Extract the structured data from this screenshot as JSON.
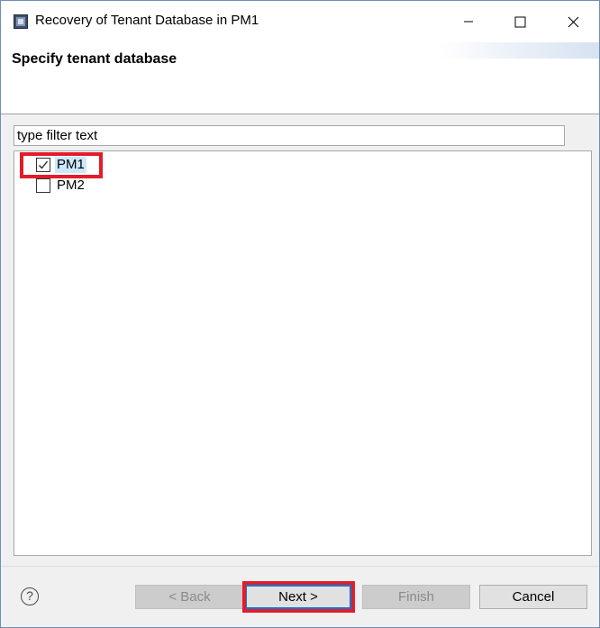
{
  "window": {
    "title": "Recovery of Tenant Database in PM1",
    "icon": "database-app-icon",
    "controls": [
      "minimize-icon",
      "maximize-icon",
      "close-icon"
    ]
  },
  "wizard": {
    "page_title": "Specify tenant database"
  },
  "filter": {
    "value": "type filter text"
  },
  "tree": {
    "items": [
      {
        "label": "PM1",
        "checked": true,
        "selected": true
      },
      {
        "label": "PM2",
        "checked": false,
        "selected": false
      }
    ]
  },
  "buttons": {
    "help": "?",
    "back": "< Back",
    "next": "Next >",
    "finish": "Finish",
    "cancel": "Cancel"
  },
  "colors": {
    "annotation": "#e11d2b",
    "selection": "#cce8ff",
    "focus": "#0078d7"
  }
}
